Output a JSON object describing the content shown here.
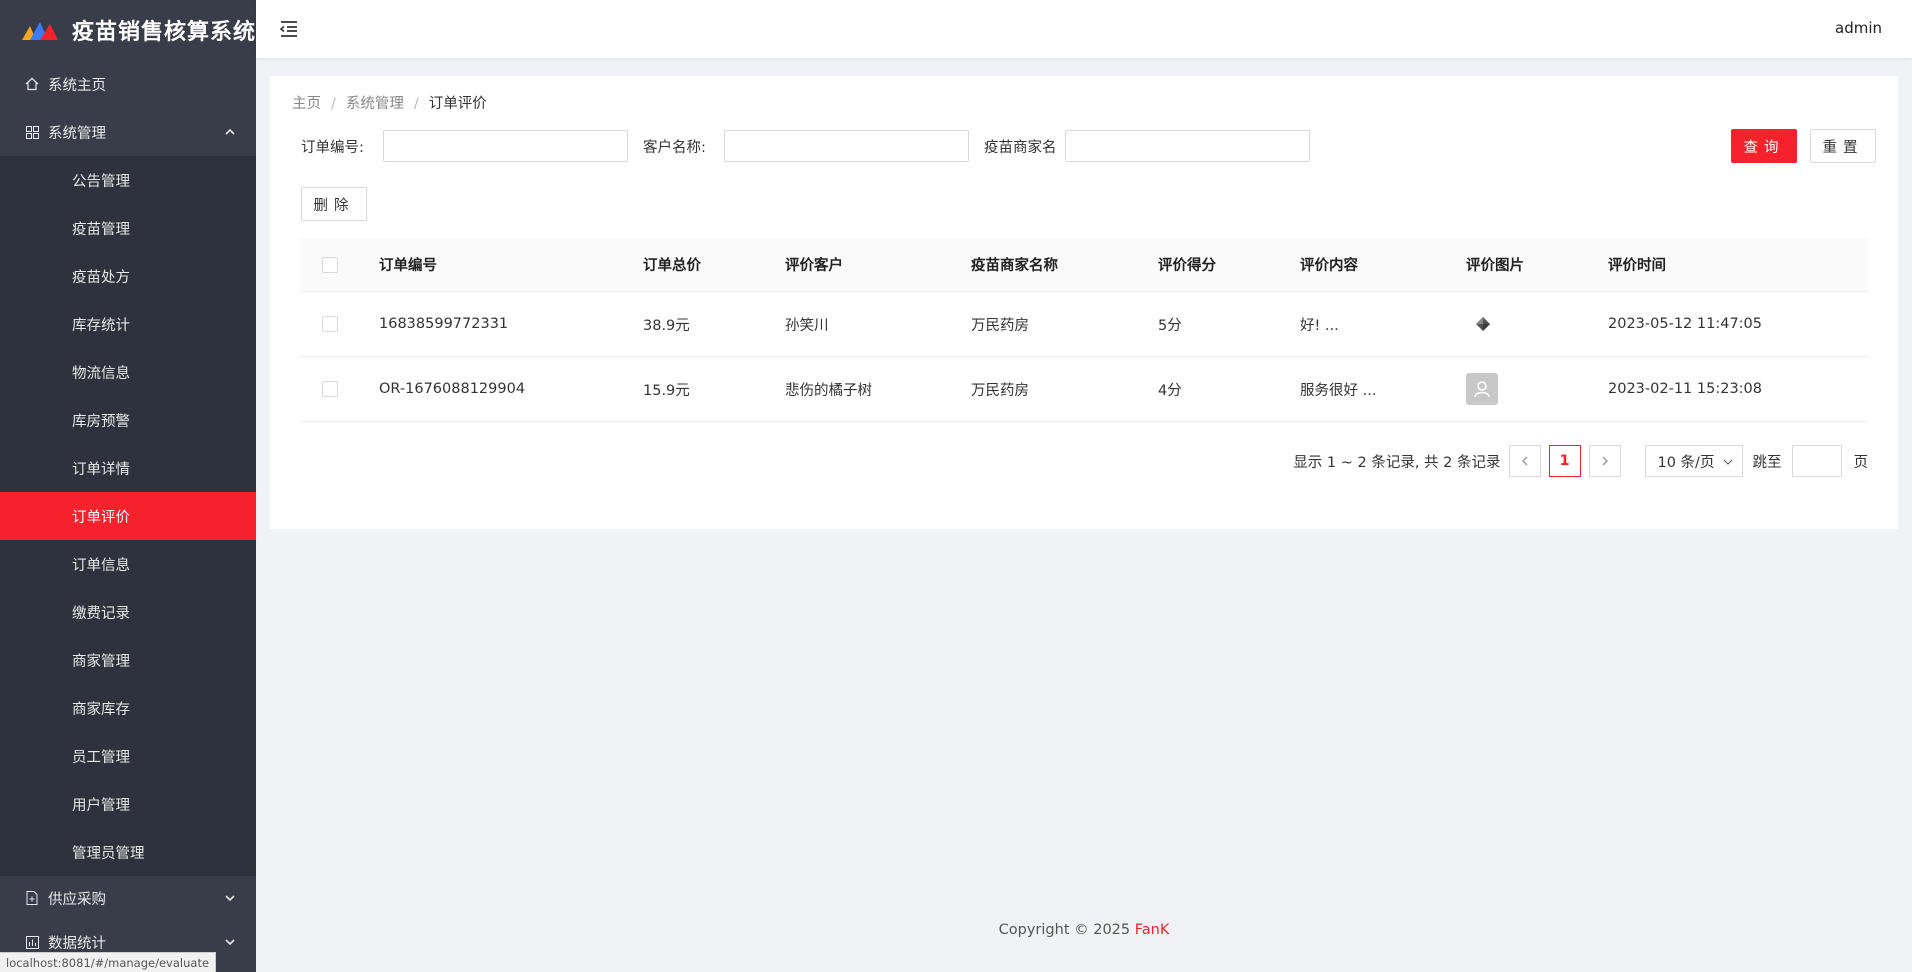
{
  "app": {
    "title": "疫苗销售核算系统",
    "user": "admin"
  },
  "sidebar": {
    "home": "系统主页",
    "system": {
      "label": "系统管理",
      "items": [
        {
          "label": "公告管理"
        },
        {
          "label": "疫苗管理"
        },
        {
          "label": "疫苗处方"
        },
        {
          "label": "库存统计"
        },
        {
          "label": "物流信息"
        },
        {
          "label": "库房预警"
        },
        {
          "label": "订单详情"
        },
        {
          "label": "订单评价",
          "active": true
        },
        {
          "label": "订单信息"
        },
        {
          "label": "缴费记录"
        },
        {
          "label": "商家管理"
        },
        {
          "label": "商家库存"
        },
        {
          "label": "员工管理"
        },
        {
          "label": "用户管理"
        },
        {
          "label": "管理员管理"
        }
      ]
    },
    "supply": "供应采购",
    "stats": "数据统计"
  },
  "breadcrumb": {
    "home": "主页",
    "section": "系统管理",
    "current": "订单评价",
    "separator": "/"
  },
  "filters": {
    "order_no_label": "订单编号:",
    "order_no_value": "",
    "customer_label": "客户名称:",
    "customer_value": "",
    "merchant_label": "疫苗商家名",
    "merchant_value": "",
    "query_label": "查询",
    "reset_label": "重置"
  },
  "actions": {
    "delete_label": "删除"
  },
  "table": {
    "columns": [
      "订单编号",
      "订单总价",
      "评价客户",
      "疫苗商家名称",
      "评价得分",
      "评价内容",
      "评价图片",
      "评价时间"
    ],
    "rows": [
      {
        "order_no": "16838599772331",
        "total": "38.9元",
        "customer": "孙笑川",
        "merchant": "万民药房",
        "score": "5分",
        "content": "好!  ...",
        "image": "product-thumbnail",
        "time": "2023-05-12 11:47:05"
      },
      {
        "order_no": "OR-1676088129904",
        "total": "15.9元",
        "customer": "悲伤的橘子树",
        "merchant": "万民药房",
        "score": "4分",
        "content": "服务很好 ...",
        "image": "avatar-placeholder",
        "time": "2023-02-11 15:23:08"
      }
    ]
  },
  "pagination": {
    "summary": "显示 1 ~ 2 条记录, 共 2 条记录",
    "current_page": "1",
    "page_size": "10 条/页",
    "jump_label": "跳至",
    "jump_value": "",
    "page_unit": "页"
  },
  "footer": {
    "copyright": "Copyright © 2025",
    "author": "FanK"
  },
  "status_url": "localhost:8081/#/manage/evaluate",
  "colors": {
    "accent": "#f5222d",
    "sidebar_bg": "#393d49",
    "submenu_bg": "#2e323c"
  }
}
